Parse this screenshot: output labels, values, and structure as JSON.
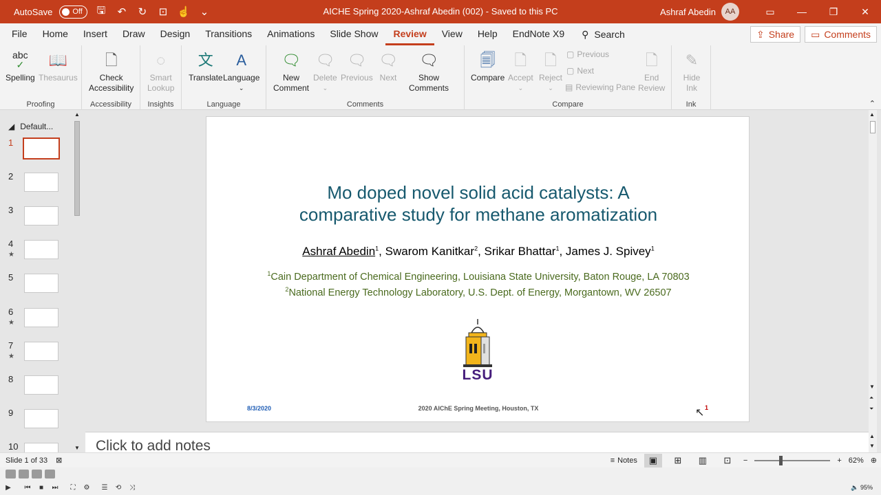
{
  "titlebar": {
    "autosave_label": "AutoSave",
    "autosave_state": "Off",
    "doc_title": "AICHE Spring 2020-Ashraf Abedin (002)  -  Saved to this PC",
    "user_name": "Ashraf Abedin",
    "user_initials": "AA"
  },
  "menu": {
    "tabs": [
      "File",
      "Home",
      "Insert",
      "Draw",
      "Design",
      "Transitions",
      "Animations",
      "Slide Show",
      "Review",
      "View",
      "Help",
      "EndNote X9"
    ],
    "search": "Search",
    "share": "Share",
    "comments": "Comments"
  },
  "ribbon": {
    "proofing": {
      "label": "Proofing",
      "spelling": "Spelling",
      "spelling_icon_text": "abc",
      "thesaurus": "Thesaurus"
    },
    "accessibility": {
      "label": "Accessibility",
      "check1": "Check",
      "check2": "Accessibility"
    },
    "insights": {
      "label": "Insights",
      "smart1": "Smart",
      "smart2": "Lookup"
    },
    "language": {
      "label": "Language",
      "translate": "Translate",
      "language": "Language"
    },
    "comments": {
      "label": "Comments",
      "new1": "New",
      "new2": "Comment",
      "delete": "Delete",
      "previous": "Previous",
      "next": "Next",
      "show1": "Show",
      "show2": "Comments"
    },
    "compare": {
      "label": "Compare",
      "compare": "Compare",
      "accept": "Accept",
      "reject": "Reject",
      "previous": "Previous",
      "next": "Next",
      "reviewing_pane": "Reviewing Pane",
      "end1": "End",
      "end2": "Review"
    },
    "ink": {
      "label": "Ink",
      "hide1": "Hide",
      "hide2": "Ink"
    }
  },
  "thumbnails": {
    "section": "Default...",
    "items": [
      {
        "num": "1",
        "star": ""
      },
      {
        "num": "2",
        "star": ""
      },
      {
        "num": "3",
        "star": ""
      },
      {
        "num": "4",
        "star": "★"
      },
      {
        "num": "5",
        "star": ""
      },
      {
        "num": "6",
        "star": "★"
      },
      {
        "num": "7",
        "star": "★"
      },
      {
        "num": "8",
        "star": ""
      },
      {
        "num": "9",
        "star": ""
      },
      {
        "num": "10",
        "star": ""
      }
    ]
  },
  "slide": {
    "title_line1": "Mo doped novel solid acid catalysts: A",
    "title_line2": "comparative study for methane aromatization",
    "author1": "Ashraf Abedin",
    "author2": ", Swarom Kanitkar",
    "author3": ", Srikar Bhattar",
    "author4": ", James J. Spivey",
    "sup1": "1",
    "sup2": "2",
    "sup3": "1",
    "sup4": "1",
    "aff1_sup": "1",
    "aff1": "Cain Department of Chemical Engineering, Louisiana State University,  Baton Rouge, LA 70803",
    "aff2_sup": "2",
    "aff2": "National Energy Technology Laboratory, U.S. Dept. of Energy, Morgantown, WV 26507",
    "logo_text": "LSU",
    "date": "8/3/2020",
    "conference": "2020 AIChE Spring Meeting, Houston, TX",
    "slide_number": "1"
  },
  "notes": {
    "placeholder": "Click to add notes"
  },
  "status": {
    "slide_of": "Slide 1 of 33",
    "notes": "Notes",
    "zoom": "62%",
    "volume": "95%"
  },
  "colors": {
    "accent": "#c43e1c",
    "title": "#17596e",
    "affiliation": "#4a6a1e"
  }
}
